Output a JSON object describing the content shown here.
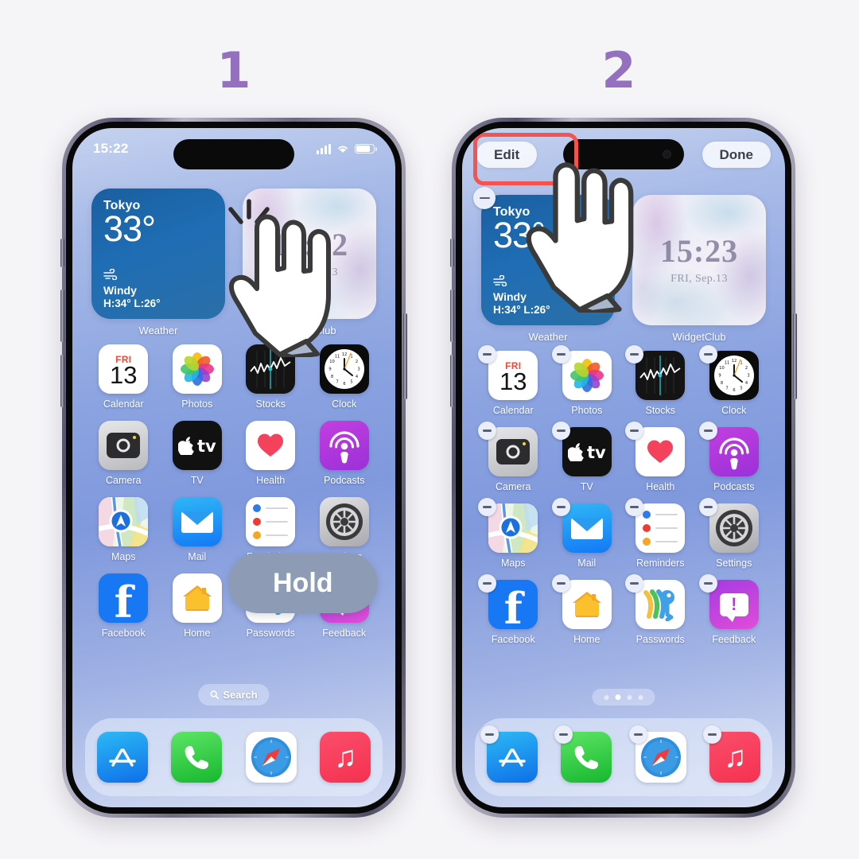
{
  "steps": [
    {
      "number": "1"
    },
    {
      "number": "2"
    }
  ],
  "phone1": {
    "statusbar": {
      "time": "15:22",
      "signal_icon": "cellular-bars-icon",
      "wifi_icon": "wifi-icon",
      "battery_icon": "battery-icon"
    },
    "widgets": [
      {
        "type": "weather",
        "city": "Tokyo",
        "temp": "33°",
        "condition": "Windy",
        "highlow": "H:34° L:26°",
        "label": "Weather",
        "wind_icon": "wind-icon"
      },
      {
        "type": "widgetclub",
        "time": "15:22",
        "date": "FRI, Sep.13",
        "label": "WidgetClub"
      }
    ],
    "apps": [
      [
        {
          "name": "Calendar",
          "icon": "calendar-icon",
          "day_label": "FRI",
          "day_number": "13"
        },
        {
          "name": "Photos",
          "icon": "photos-icon"
        },
        {
          "name": "Stocks",
          "icon": "stocks-icon"
        },
        {
          "name": "Clock",
          "icon": "clock-icon"
        }
      ],
      [
        {
          "name": "Camera",
          "icon": "camera-icon"
        },
        {
          "name": "TV",
          "icon": "apple-tv-icon"
        },
        {
          "name": "Health",
          "icon": "health-icon"
        },
        {
          "name": "Podcasts",
          "icon": "podcasts-icon"
        }
      ],
      [
        {
          "name": "Maps",
          "icon": "maps-icon"
        },
        {
          "name": "Mail",
          "icon": "mail-icon"
        },
        {
          "name": "Reminders",
          "icon": "reminders-icon"
        },
        {
          "name": "Settings",
          "icon": "settings-icon"
        }
      ],
      [
        {
          "name": "Facebook",
          "icon": "facebook-icon"
        },
        {
          "name": "Home",
          "icon": "home-icon"
        },
        {
          "name": "Passwords",
          "icon": "passwords-icon"
        },
        {
          "name": "Feedback",
          "icon": "feedback-icon"
        }
      ]
    ],
    "search": {
      "label": "Search",
      "icon": "search-icon"
    },
    "dock": [
      {
        "name": "App Store",
        "icon": "app-store-icon"
      },
      {
        "name": "Phone",
        "icon": "phone-icon"
      },
      {
        "name": "Safari",
        "icon": "safari-icon"
      },
      {
        "name": "Music",
        "icon": "music-icon"
      }
    ],
    "gesture": {
      "label": "Hold",
      "cursor_icon": "hand-pointer-icon",
      "tap_lines_icon": "tap-burst-icon"
    }
  },
  "phone2": {
    "edit_button": "Edit",
    "done_button": "Done",
    "edit_mode": true,
    "remove_badge_icon": "minus-badge-icon",
    "highlight_color": "#F4534F",
    "widgets": [
      {
        "type": "weather",
        "city": "Tokyo",
        "temp": "33°",
        "condition": "Windy",
        "highlow": "H:34° L:26°",
        "label": "Weather",
        "wind_icon": "wind-icon"
      },
      {
        "type": "widgetclub",
        "time": "15:23",
        "date": "FRI, Sep.13",
        "label": "WidgetClub"
      }
    ],
    "apps": [
      [
        {
          "name": "Calendar",
          "icon": "calendar-icon",
          "day_label": "FRI",
          "day_number": "13"
        },
        {
          "name": "Photos",
          "icon": "photos-icon"
        },
        {
          "name": "Stocks",
          "icon": "stocks-icon"
        },
        {
          "name": "Clock",
          "icon": "clock-icon"
        }
      ],
      [
        {
          "name": "Camera",
          "icon": "camera-icon"
        },
        {
          "name": "TV",
          "icon": "apple-tv-icon"
        },
        {
          "name": "Health",
          "icon": "health-icon"
        },
        {
          "name": "Podcasts",
          "icon": "podcasts-icon"
        }
      ],
      [
        {
          "name": "Maps",
          "icon": "maps-icon"
        },
        {
          "name": "Mail",
          "icon": "mail-icon"
        },
        {
          "name": "Reminders",
          "icon": "reminders-icon"
        },
        {
          "name": "Settings",
          "icon": "settings-icon"
        }
      ],
      [
        {
          "name": "Facebook",
          "icon": "facebook-icon"
        },
        {
          "name": "Home",
          "icon": "home-icon"
        },
        {
          "name": "Passwords",
          "icon": "passwords-icon"
        },
        {
          "name": "Feedback",
          "icon": "feedback-icon"
        }
      ]
    ],
    "page_dots": {
      "count": 4,
      "active_index": 1
    },
    "dock": [
      {
        "name": "App Store",
        "icon": "app-store-icon"
      },
      {
        "name": "Phone",
        "icon": "phone-icon"
      },
      {
        "name": "Safari",
        "icon": "safari-icon"
      },
      {
        "name": "Music",
        "icon": "music-icon"
      }
    ],
    "gesture": {
      "cursor_icon": "hand-pointer-icon"
    }
  },
  "colors": {
    "background": "#F5F4F7",
    "step_number": "#9470BE",
    "highlight": "#F4534F",
    "tooltip_bg": "#8D9BB4"
  }
}
